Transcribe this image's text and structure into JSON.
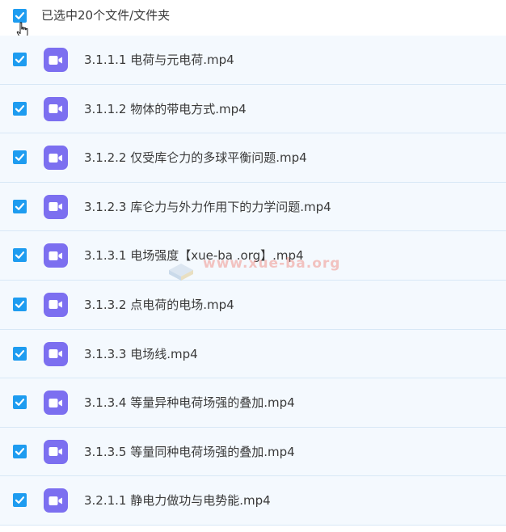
{
  "header": {
    "title": "已选中20个文件/文件夹",
    "select_all_checked": true
  },
  "files": [
    {
      "name": "3.1.1.1 电荷与元电荷.mp4",
      "checked": true,
      "icon": "video-file-icon"
    },
    {
      "name": "3.1.1.2 物体的带电方式.mp4",
      "checked": true,
      "icon": "video-file-icon"
    },
    {
      "name": "3.1.2.2 仅受库仑力的多球平衡问题.mp4",
      "checked": true,
      "icon": "video-file-icon"
    },
    {
      "name": "3.1.2.3 库仑力与外力作用下的力学问题.mp4",
      "checked": true,
      "icon": "video-file-icon"
    },
    {
      "name": "3.1.3.1 电场强度【xue-ba .org】.mp4",
      "checked": true,
      "icon": "video-file-icon"
    },
    {
      "name": "3.1.3.2 点电荷的电场.mp4",
      "checked": true,
      "icon": "video-file-icon"
    },
    {
      "name": "3.1.3.3 电场线.mp4",
      "checked": true,
      "icon": "video-file-icon"
    },
    {
      "name": "3.1.3.4 等量异种电荷场强的叠加.mp4",
      "checked": true,
      "icon": "video-file-icon"
    },
    {
      "name": "3.1.3.5 等量同种电荷场强的叠加.mp4",
      "checked": true,
      "icon": "video-file-icon"
    },
    {
      "name": "3.2.1.1 静电力做功与电势能.mp4",
      "checked": true,
      "icon": "video-file-icon"
    }
  ],
  "watermark": {
    "text": "www.xue-ba.org"
  },
  "colors": {
    "checkbox": "#1e9cf0",
    "video_icon": "#7c6ff0",
    "row_background": "#f4f9fe",
    "row_border": "#d8e8f6",
    "text": "#3a3a3a"
  }
}
